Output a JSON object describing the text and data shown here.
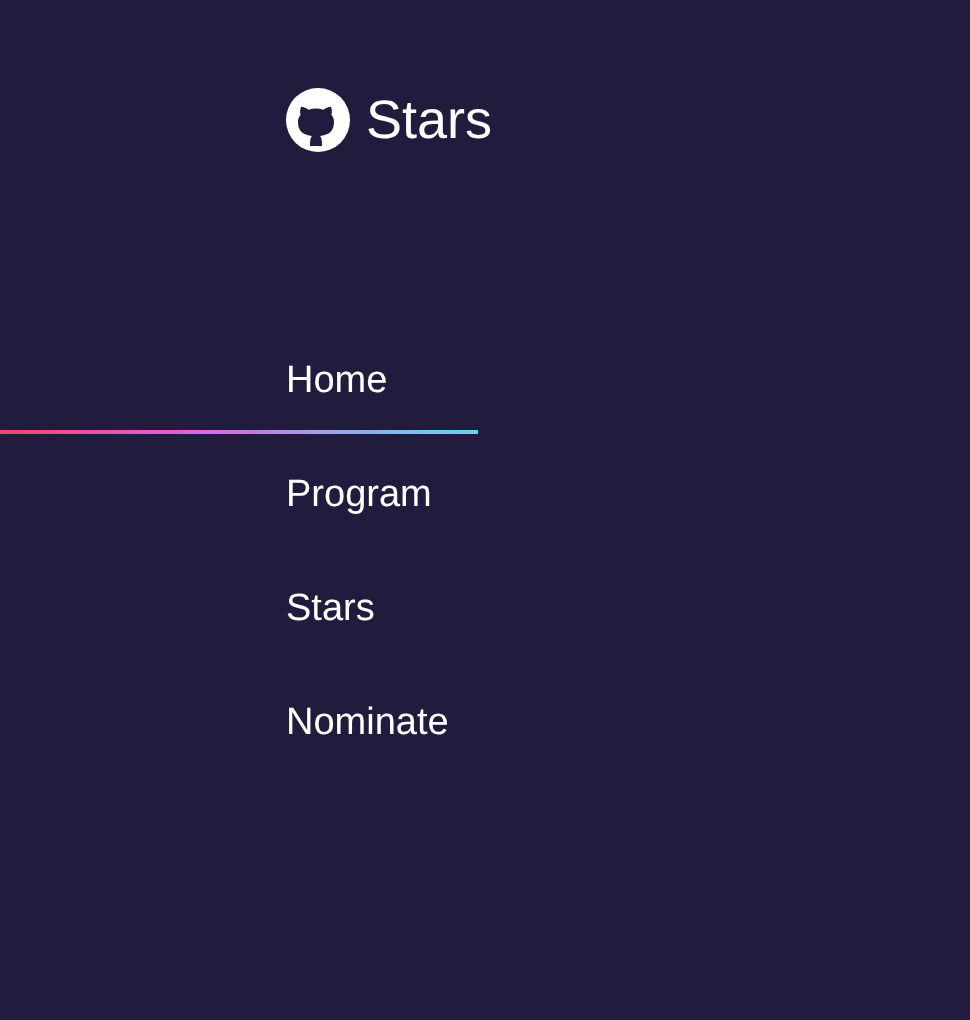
{
  "header": {
    "title": "Stars"
  },
  "nav": [
    {
      "label": "Home",
      "selected": true
    },
    {
      "label": "Program",
      "selected": false
    },
    {
      "label": "Stars",
      "selected": false
    },
    {
      "label": "Nominate",
      "selected": false
    }
  ]
}
